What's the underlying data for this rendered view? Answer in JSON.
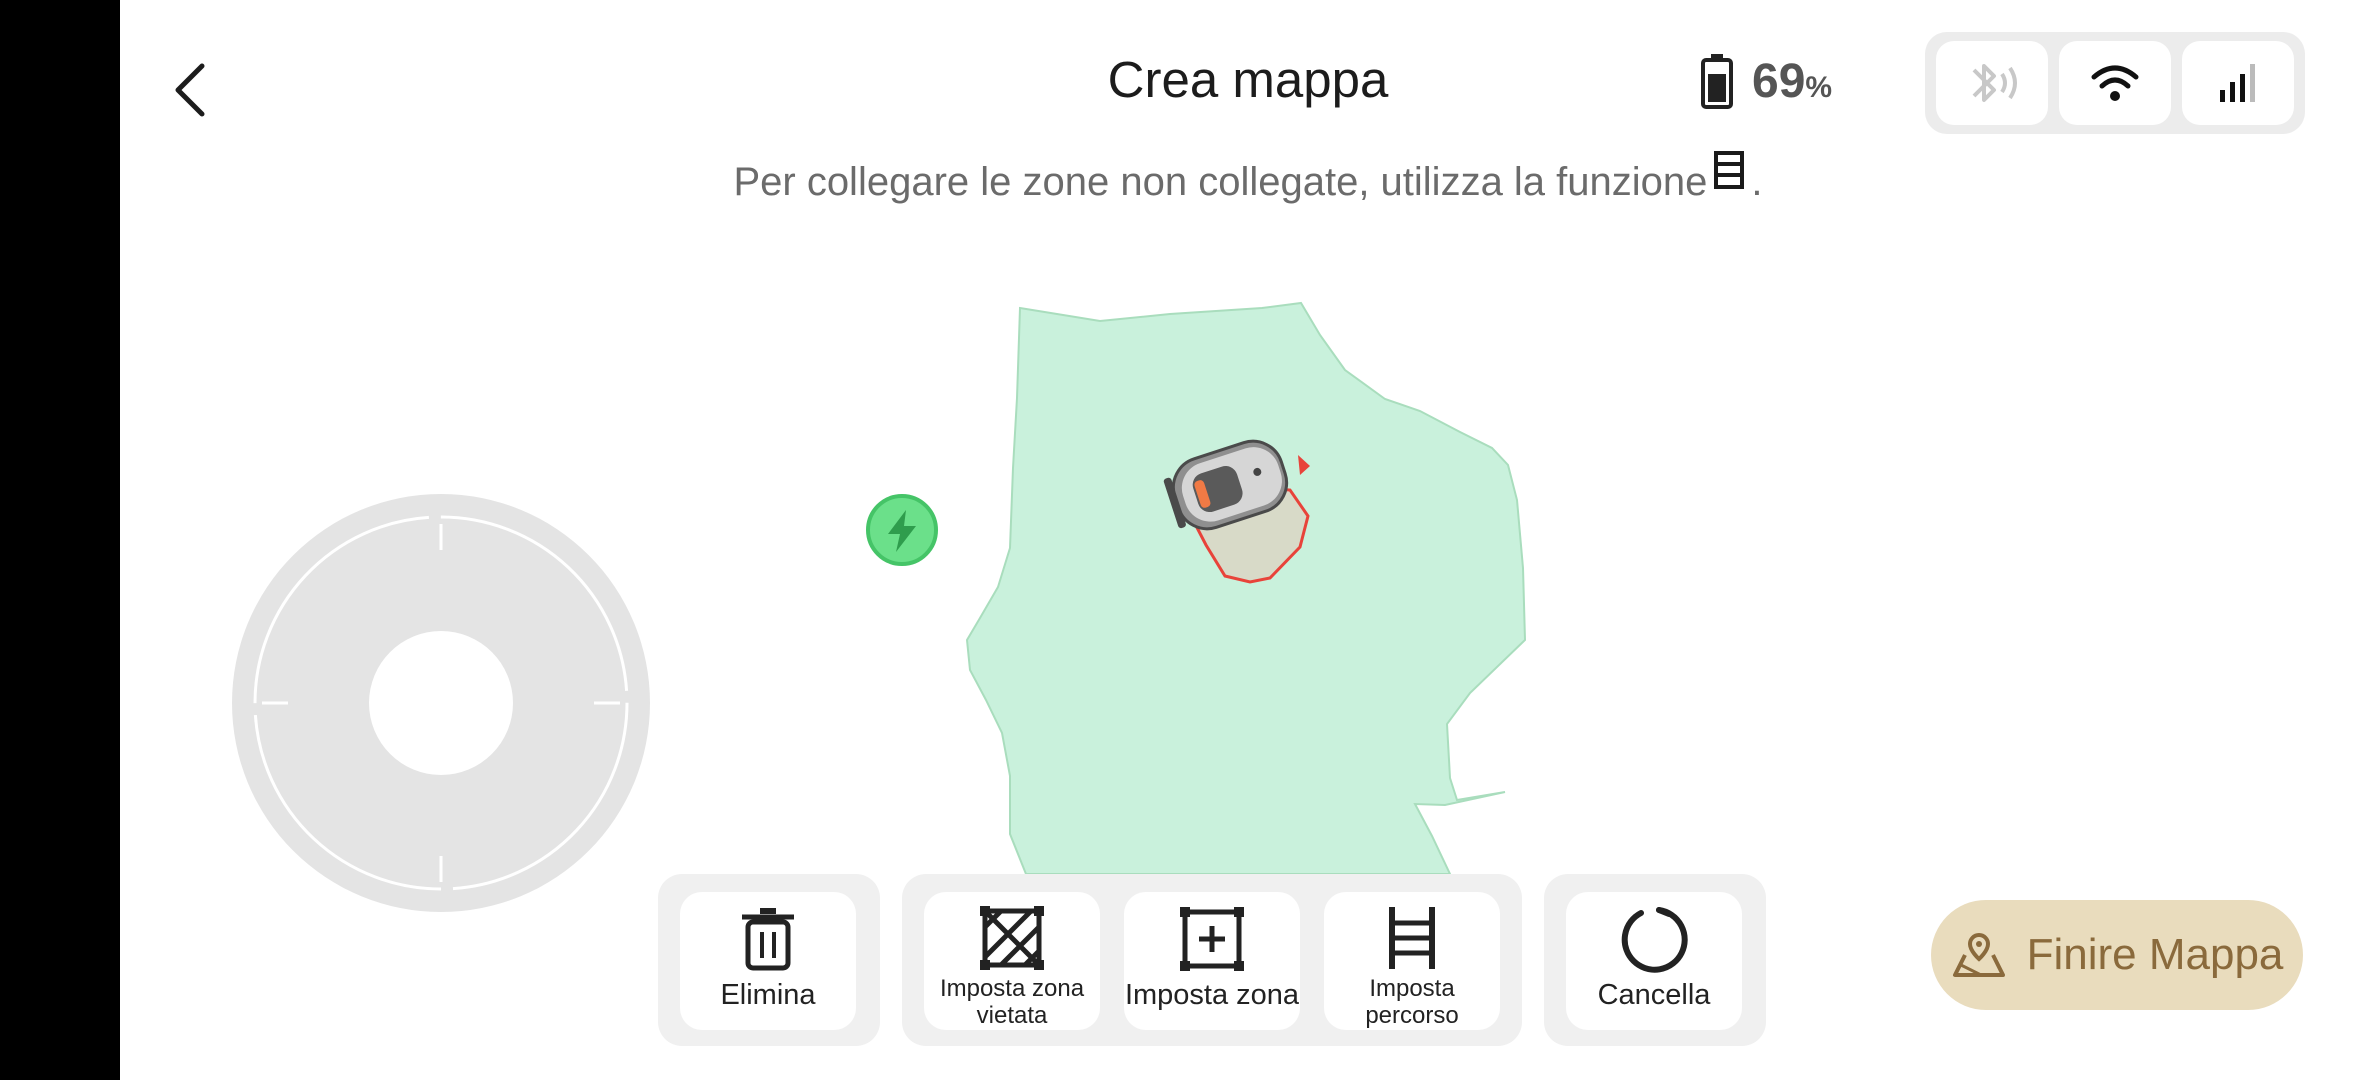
{
  "header": {
    "title": "Crea mappa",
    "battery_value": "69",
    "battery_unit": "%"
  },
  "hint": {
    "text": "Per collegare le zone non collegate, utilizza la funzione",
    "suffix": "."
  },
  "toolbar": {
    "delete_label": "Elimina",
    "no_go_zone_label": "Imposta zona vietata",
    "set_zone_label": "Imposta zona",
    "set_path_label": "Imposta percorso",
    "cancel_label": "Cancella"
  },
  "finish_button": {
    "label": "Finire Mappa"
  },
  "icons": {
    "back": "chevron-left-icon",
    "battery": "battery-icon",
    "bluetooth": "bluetooth-icon",
    "wifi": "wifi-icon",
    "cellular": "cellular-signal-icon",
    "ladder": "ladder-icon",
    "charging": "charging-station-icon",
    "trash": "trash-icon",
    "no_go": "no-go-zone-icon",
    "zone": "add-zone-icon",
    "path": "ladder-icon",
    "undo": "undo-icon",
    "map_pin": "map-pin-icon"
  },
  "colors": {
    "lawn_fill": "#c9f1dc",
    "mowed_outline": "#e8433a",
    "charging_green": "#5cd87a",
    "finish_bg": "#e9dcbd",
    "finish_text": "#8a6a3c",
    "bluetooth_disabled": "#c8c8c8"
  }
}
